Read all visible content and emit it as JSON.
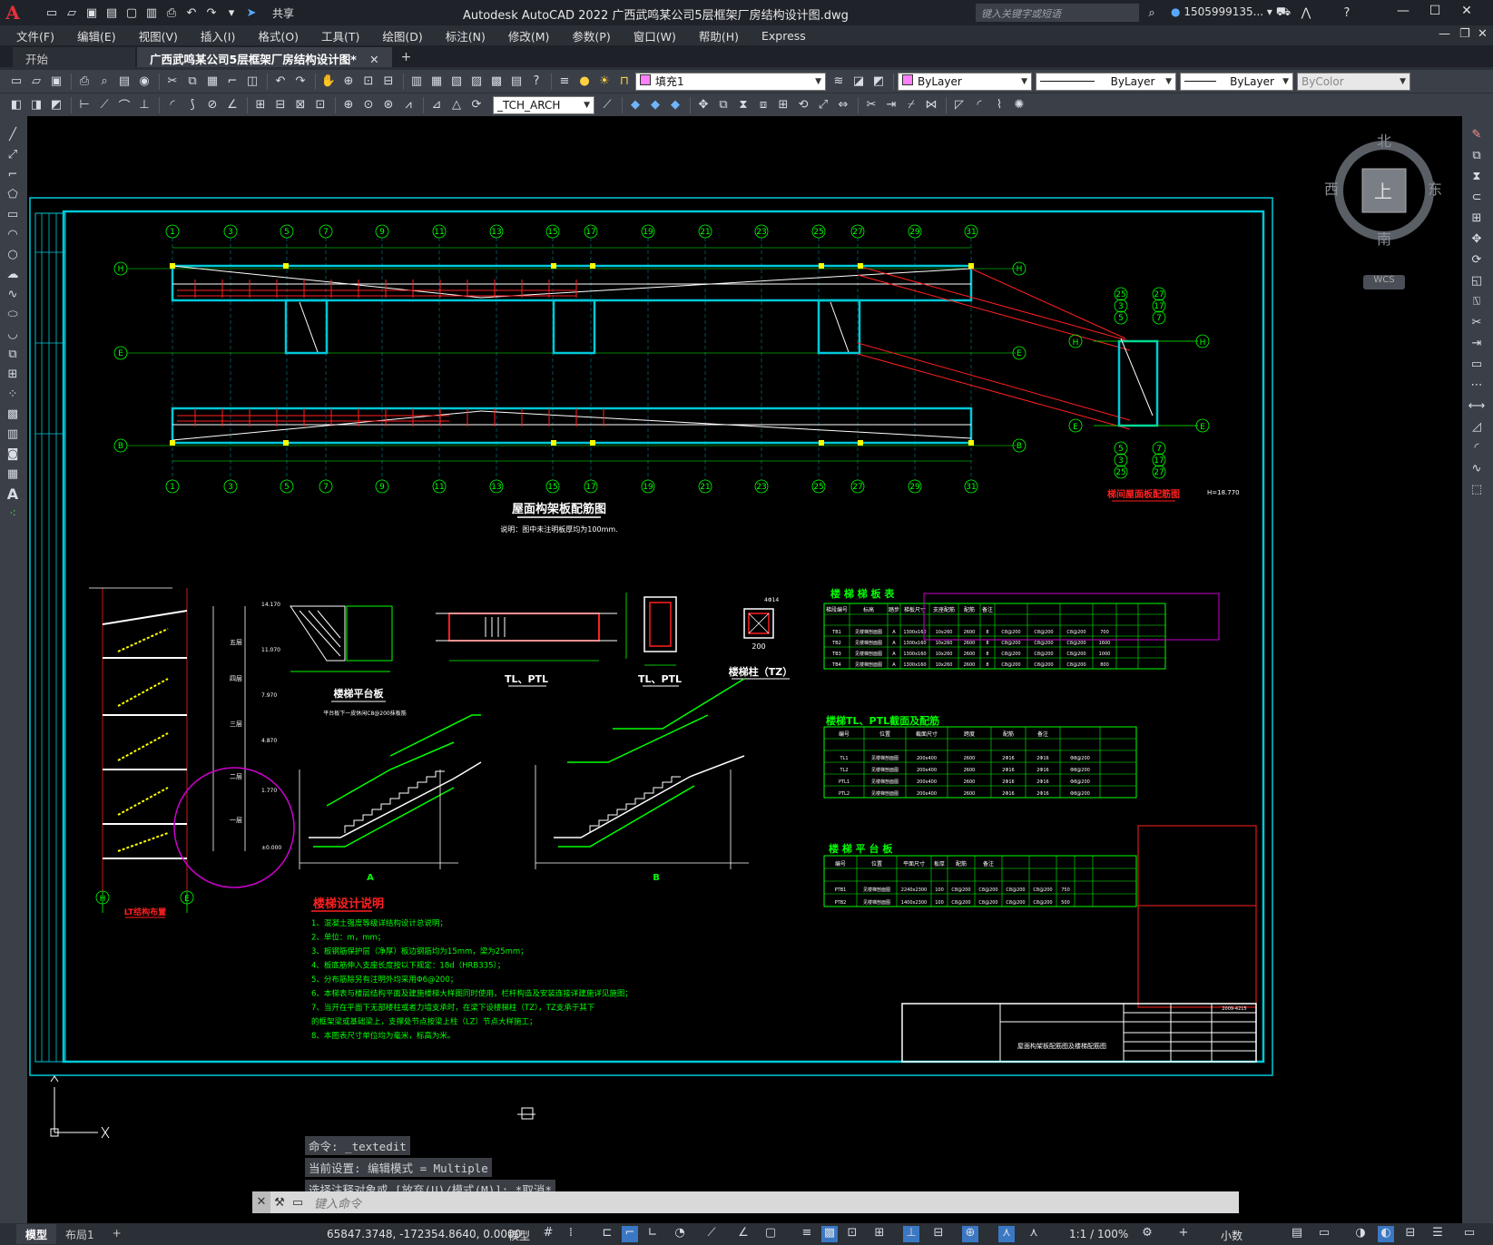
{
  "titlebar": {
    "app_logo": "A",
    "share": "共享",
    "title": "Autodesk AutoCAD 2022    广西武鸣某公司5层框架厂房结构设计图.dwg",
    "search_placeholder": "键入关键字或短语",
    "user": "1505999135...",
    "minimize": "—",
    "maximize": "☐",
    "close": "✕"
  },
  "menubar": {
    "items": [
      "文件(F)",
      "编辑(E)",
      "视图(V)",
      "插入(I)",
      "格式(O)",
      "工具(T)",
      "绘图(D)",
      "标注(N)",
      "修改(M)",
      "参数(P)",
      "窗口(W)",
      "帮助(H)",
      "Express"
    ]
  },
  "tabs": {
    "start": "开始",
    "active": "广西武鸣某公司5层框架厂房结构设计图*",
    "close": "✕",
    "new": "+"
  },
  "toolbar1": {
    "layer_value": "填充1",
    "color_value": "ByLayer",
    "linetype_value": "ByLayer",
    "lineweight_value": "ByLayer",
    "plotstyle_value": "ByColor"
  },
  "toolbar2": {
    "textstyle_value": "_TCH_ARCH"
  },
  "viewcube": {
    "north": "北",
    "south": "南",
    "east": "东",
    "west": "西",
    "top": "上",
    "wcs": "WCS"
  },
  "drawing": {
    "grid_numbers": [
      "1",
      "3",
      "5",
      "7",
      "9",
      "11",
      "13",
      "15",
      "17",
      "19",
      "21",
      "23",
      "25",
      "27",
      "29",
      "31"
    ],
    "row_labels": [
      "H",
      "E",
      "B"
    ],
    "small_plan_top": [
      "25",
      "27",
      "3",
      "17",
      "5",
      "7"
    ],
    "small_plan_bottom": [
      "5",
      "7",
      "3",
      "17",
      "25",
      "27"
    ],
    "plan_title": "屋面构架板配筋图",
    "plan_note": "说明：图中未注明板厚均为100mm.",
    "stair_plan_title": "梯间屋面板配筋图",
    "stair_plan_elev": "H=18.770",
    "platform_title": "楼梯平台板",
    "platform_note": "平台板下一皮休闲C8@200抹板筋",
    "tl_label1": "TL、PTL",
    "tl_label2": "TL、PTL",
    "tz_label": "楼梯柱（TZ）",
    "tz_dim": "200",
    "tz_rebar": "4Φ14",
    "section_a": "A",
    "section_b": "B",
    "lt_label": "LT结构布置",
    "lt_rows": [
      "H",
      "E"
    ],
    "floor_names": [
      "五层",
      "四层",
      "三层",
      "二层",
      "一层"
    ],
    "elevations": [
      "14.170",
      "11.070",
      "7.970",
      "4.870",
      "1.770",
      "±0.000"
    ],
    "table1_title": "楼 梯 梯 板 表",
    "table2_title": "楼梯TL、PTL截面及配筋",
    "table3_title": "楼 梯 平 台 板",
    "table1_headers": [
      "梯段编号",
      "标高",
      "踏步",
      "梯板尺寸",
      "支座配筋",
      "配筋",
      "备注"
    ],
    "table1_rows": [
      [
        "TB1",
        "见楼梯剖面图",
        "A",
        "1300x160",
        "10x260",
        "2600",
        "8",
        "C8@200",
        "C8@200",
        "C8@200",
        "700"
      ],
      [
        "TB2",
        "见楼梯剖面图",
        "A",
        "1300x160",
        "10x260",
        "2600",
        "8",
        "C8@200",
        "C8@200",
        "C8@200",
        "1600"
      ],
      [
        "TB3",
        "见楼梯剖面图",
        "A",
        "1300x160",
        "10x260",
        "2600",
        "8",
        "C8@200",
        "C8@200",
        "C8@200",
        "1000"
      ],
      [
        "TB4",
        "见楼梯剖面图",
        "A",
        "1300x160",
        "10x260",
        "2600",
        "8",
        "C8@200",
        "C8@200",
        "C8@200",
        "800"
      ]
    ],
    "table2_headers": [
      "编号",
      "位置",
      "截面尺寸",
      "跨度",
      "配筋",
      "备注"
    ],
    "table2_rows": [
      [
        "TL1",
        "见楼梯剖面图",
        "200x400",
        "2600",
        "2Φ16",
        "2Φ16",
        "Φ8@200"
      ],
      [
        "TL2",
        "见楼梯剖面图",
        "200x400",
        "2600",
        "2Φ16",
        "2Φ16",
        "Φ8@200"
      ],
      [
        "PTL1",
        "见楼梯剖面图",
        "200x400",
        "2600",
        "2Φ16",
        "2Φ16",
        "Φ8@200"
      ],
      [
        "PTL2",
        "见楼梯剖面图",
        "200x400",
        "2600",
        "2Φ16",
        "2Φ16",
        "Φ8@200"
      ]
    ],
    "table3_headers": [
      "编号",
      "位置",
      "平面尺寸",
      "板厚",
      "配筋",
      "备注"
    ],
    "table3_rows": [
      [
        "PTB1",
        "见楼梯剖面图",
        "2240x2300",
        "100",
        "C8@200",
        "C8@200",
        "C8@200",
        "C8@200",
        "750"
      ],
      [
        "PTB2",
        "见楼梯剖面图",
        "1400x2300",
        "100",
        "C8@200",
        "C8@200",
        "C8@200",
        "C8@200",
        "500"
      ]
    ],
    "notes_title": "楼梯设计说明",
    "notes": [
      "1、混凝土强度等级详结构设计总说明；",
      "2、单位：m，mm；",
      "3、板钢筋保护层（净厚）板边钢筋均为15mm，梁为25mm；",
      "4、板底筋伸入支座长度按以下规定：18d（HRB335）；",
      "5、分布筋除另有注明外均采用Φ6@200；",
      "6、本梯表与楼层结构平面及建施楼梯大样图同时使用，栏杆构造及安装连接详建施详见施图；",
      "7、当开在平面下无部楼柱或者力墙支承时，在梁下设楼梯柱（TZ），TZ支承于其下",
      "   的框架梁或基础梁上，支撑处节点按梁上柱（LZ）节点大样施工；",
      "8、本图表尺寸单位均为毫米，标高为米。"
    ],
    "titleblock_text": "屋面构架板配筋图及楼梯配筋图",
    "titleblock_code": "2009-4215"
  },
  "command": {
    "history": [
      "命令: _textedit",
      "当前设置: 编辑模式 = Multiple",
      "选择注释对象或 [放弃(U)/模式(M)]: *取消*"
    ],
    "prompt": "键入命令"
  },
  "status": {
    "model_tab": "模型",
    "layout_tab": "布局1",
    "add_tab": "+",
    "coords": "65847.3748, -172354.8640, 0.0000",
    "model": "模型",
    "scale": "1:1 / 100%",
    "units": "小数"
  }
}
